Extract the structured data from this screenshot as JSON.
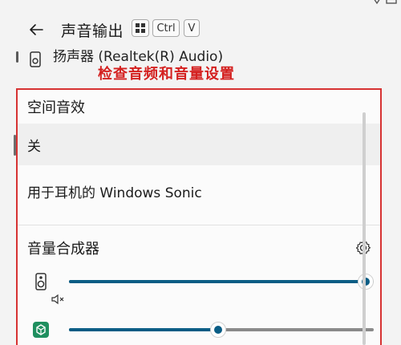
{
  "header": {
    "title": "声音输出",
    "shortcut_keys": [
      "⊞",
      "Ctrl",
      "V"
    ]
  },
  "device": {
    "label": "扬声器 (Realtek(R) Audio)"
  },
  "annotation": "检查音频和音量设置",
  "spatial_audio": {
    "title": "空间音效",
    "options": [
      {
        "label": "关",
        "selected": true
      },
      {
        "label": "用于耳机的 Windows Sonic",
        "selected": false
      }
    ]
  },
  "volume_mixer": {
    "title": "音量合成器",
    "apps": [
      {
        "icon": "speaker-icon",
        "volume_fraction": 1.0,
        "muted_icon": "mute-icon"
      },
      {
        "icon": "app-cube-icon",
        "volume_fraction": 0.49,
        "muted_icon": "mute-icon"
      }
    ]
  },
  "colors": {
    "accent": "#0a5d85",
    "annotation_red": "#d4201f",
    "app_icon_green": "#1f8f5f"
  }
}
